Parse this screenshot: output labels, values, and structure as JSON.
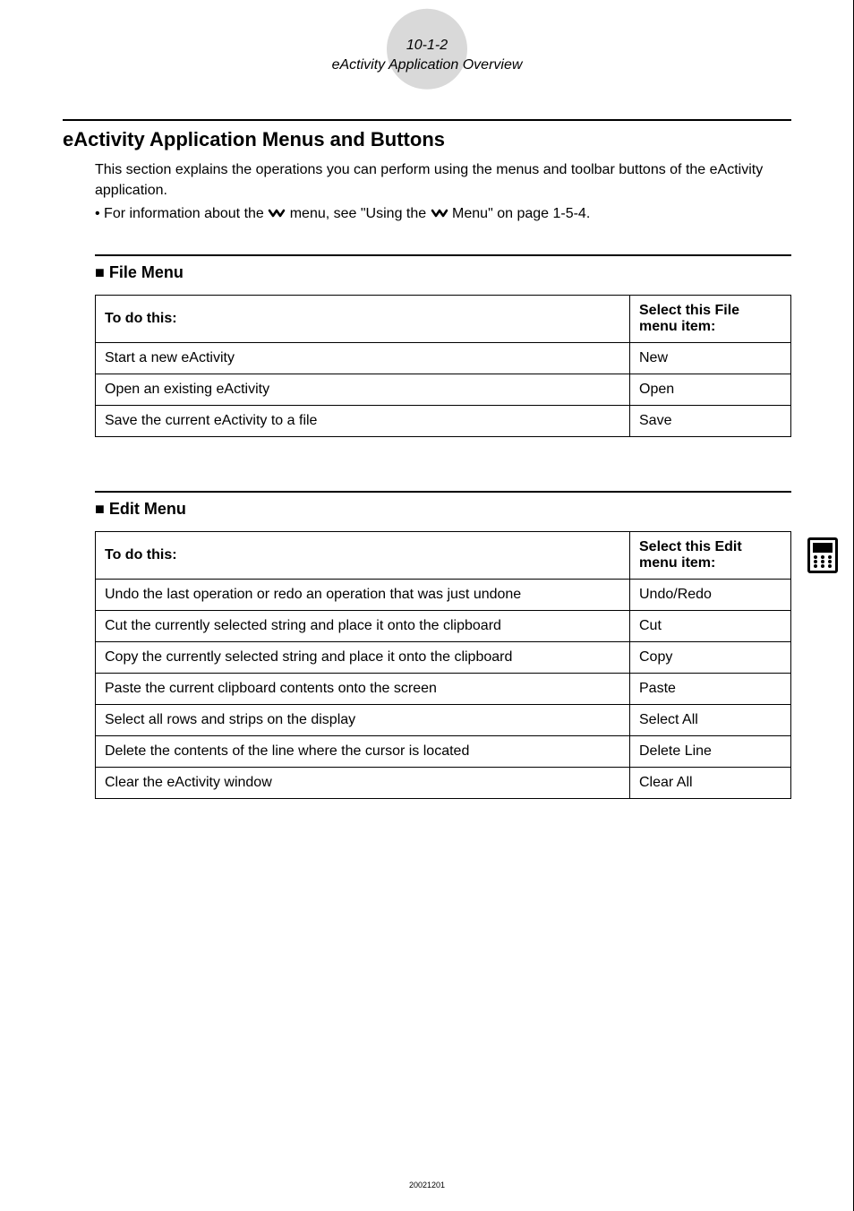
{
  "header": {
    "pageRef": "10-1-2",
    "subtitle": "eActivity Application Overview"
  },
  "sectionTitle": "eActivity Application Menus and Buttons",
  "intro": "This section explains the operations you can perform using the menus and toolbar buttons of the eActivity application.",
  "bullet": {
    "prefix": "• For information about the ",
    "mid": " menu, see \"Using the ",
    "suffix": " Menu\" on page 1-5-4."
  },
  "fileMenu": {
    "title": "File Menu",
    "colLeft": "To do this:",
    "colRight": "Select this File menu item:",
    "rows": [
      {
        "left": "Start a new eActivity",
        "right": "New"
      },
      {
        "left": "Open an existing eActivity",
        "right": "Open"
      },
      {
        "left": "Save the current eActivity to a file",
        "right": "Save"
      }
    ]
  },
  "editMenu": {
    "title": "Edit Menu",
    "colLeft": "To do this:",
    "colRight": "Select this Edit menu item:",
    "rows": [
      {
        "left": "Undo the last operation or redo an operation that was just undone",
        "right": "Undo/Redo"
      },
      {
        "left": "Cut the currently selected string and place it onto the clipboard",
        "right": "Cut"
      },
      {
        "left": "Copy the currently selected string and place it onto the clipboard",
        "right": "Copy"
      },
      {
        "left": "Paste the current clipboard contents onto the screen",
        "right": "Paste"
      },
      {
        "left": "Select all rows and strips on the display",
        "right": "Select All"
      },
      {
        "left": "Delete the contents of the line where the cursor is located",
        "right": "Delete Line"
      },
      {
        "left": "Clear the eActivity window",
        "right": "Clear All"
      }
    ]
  },
  "footer": "20021201"
}
